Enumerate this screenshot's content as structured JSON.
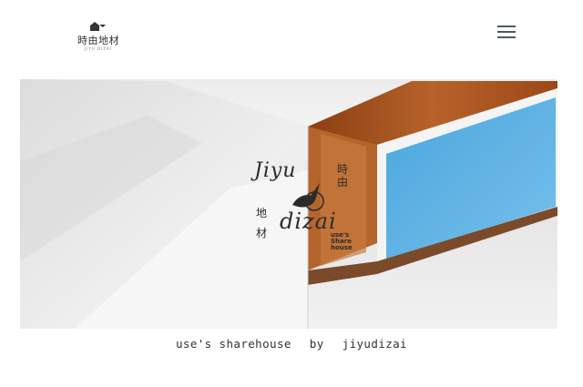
{
  "header": {
    "logo": {
      "text": "時由地材",
      "subtext": "JIYU DIZAI"
    }
  },
  "hero": {
    "logo": {
      "latin_top": "Jiyu",
      "latin_bottom": "dizai",
      "kanji_right": "時由",
      "kanji_left": "地材",
      "share_text_1": "use's",
      "share_text_2": "Share",
      "share_text_3": "house"
    },
    "colors": {
      "sky": "#5bb0e2",
      "wood": "#a9541f",
      "wall": "#e9e9e9"
    }
  },
  "tagline": {
    "part1": "use's sharehouse",
    "part2": "by",
    "part3": "jiyudizai"
  }
}
